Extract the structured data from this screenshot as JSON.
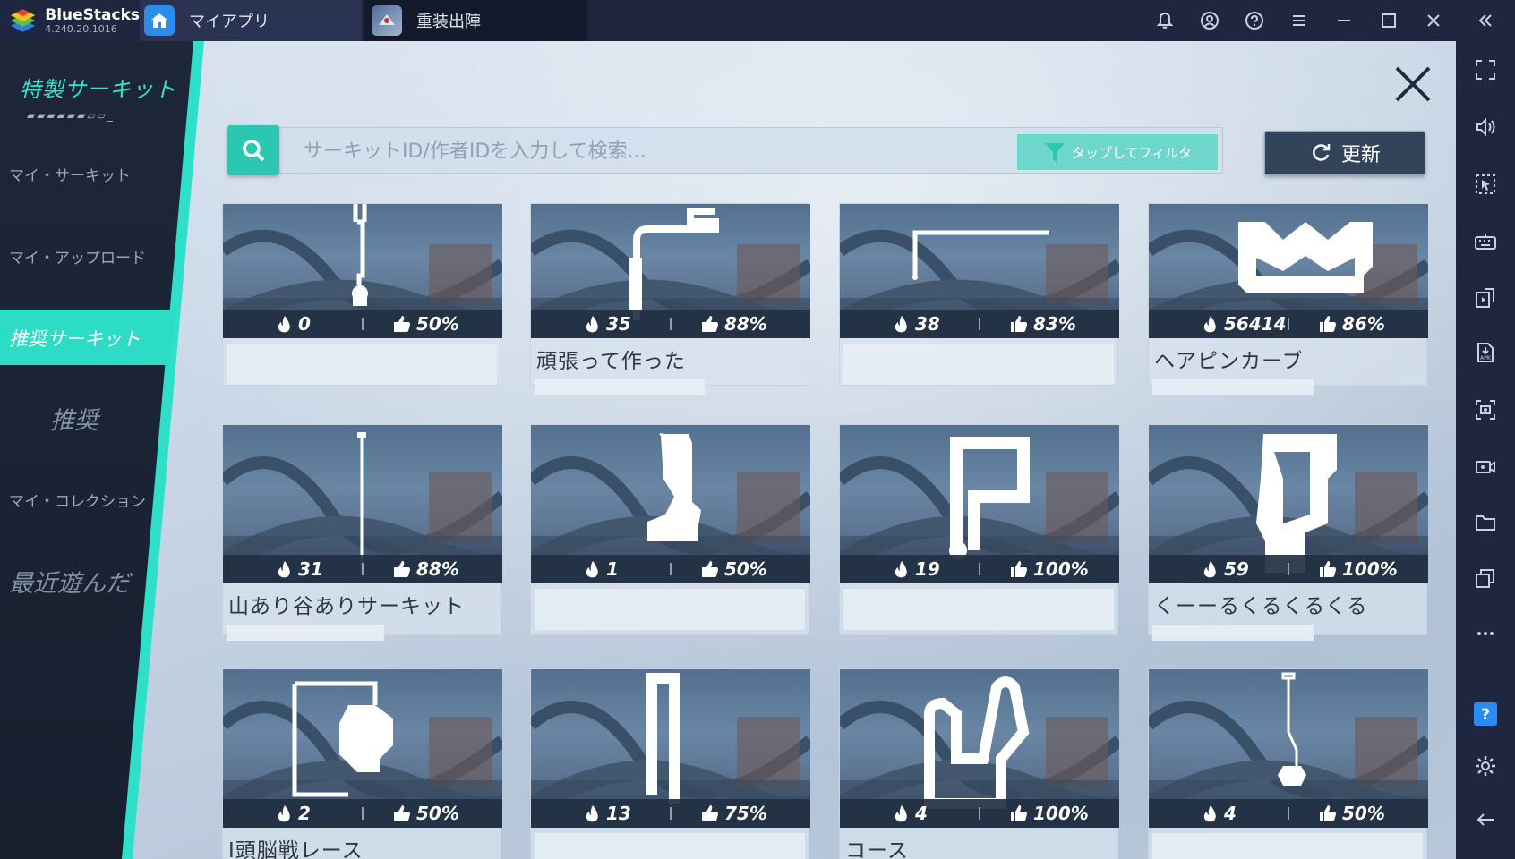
{
  "window": {
    "app_name": "BlueStacks",
    "version": "4.240.20.1016",
    "tabs": [
      {
        "label": "マイアプリ"
      },
      {
        "label": "重装出陣"
      }
    ]
  },
  "menu": {
    "title": "特製サーキット",
    "deco": "▰▰▰▰▰▰▱▱_",
    "items": {
      "my_circuit": "マイ・サーキット",
      "my_upload": "マイ・アップロード",
      "recommended_circuit": "推奨サーキット",
      "recommended": "推奨",
      "my_collection": "マイ・コレクション",
      "recent": "最近遊んだ"
    }
  },
  "search": {
    "placeholder": "サーキットID/作者IDを入力して検索...",
    "filter_label": "タップしてフィルタ",
    "refresh_label": "更新"
  },
  "colors": {
    "accent": "#2ddcc5",
    "panel": "#1d2738",
    "titlebar": "#1e2640"
  },
  "circuits": [
    {
      "plays": "0",
      "like": "50%",
      "name": ""
    },
    {
      "plays": "35",
      "like": "88%",
      "name": "頑張って作った"
    },
    {
      "plays": "38",
      "like": "83%",
      "name": ""
    },
    {
      "plays": "56414",
      "like": "86%",
      "name": "ヘアピンカーブ"
    },
    {
      "plays": "31",
      "like": "88%",
      "name": "山あり谷ありサーキット"
    },
    {
      "plays": "1",
      "like": "50%",
      "name": ""
    },
    {
      "plays": "19",
      "like": "100%",
      "name": ""
    },
    {
      "plays": "59",
      "like": "100%",
      "name": "くーーるくるくるくる"
    },
    {
      "plays": "2",
      "like": "50%",
      "name": "I頭脳戦レース"
    },
    {
      "plays": "13",
      "like": "75%",
      "name": ""
    },
    {
      "plays": "4",
      "like": "100%",
      "name": "コース"
    },
    {
      "plays": "4",
      "like": "50%",
      "name": ""
    }
  ],
  "sidebar_icons": [
    "fullscreen-icon",
    "volume-icon",
    "cursor-icon",
    "keyboard-icon",
    "install-icon",
    "apk-icon",
    "screenshot-icon",
    "record-icon",
    "folder-icon",
    "multi-instance-icon",
    "more-icon",
    "help-icon",
    "settings-icon",
    "back-icon"
  ]
}
